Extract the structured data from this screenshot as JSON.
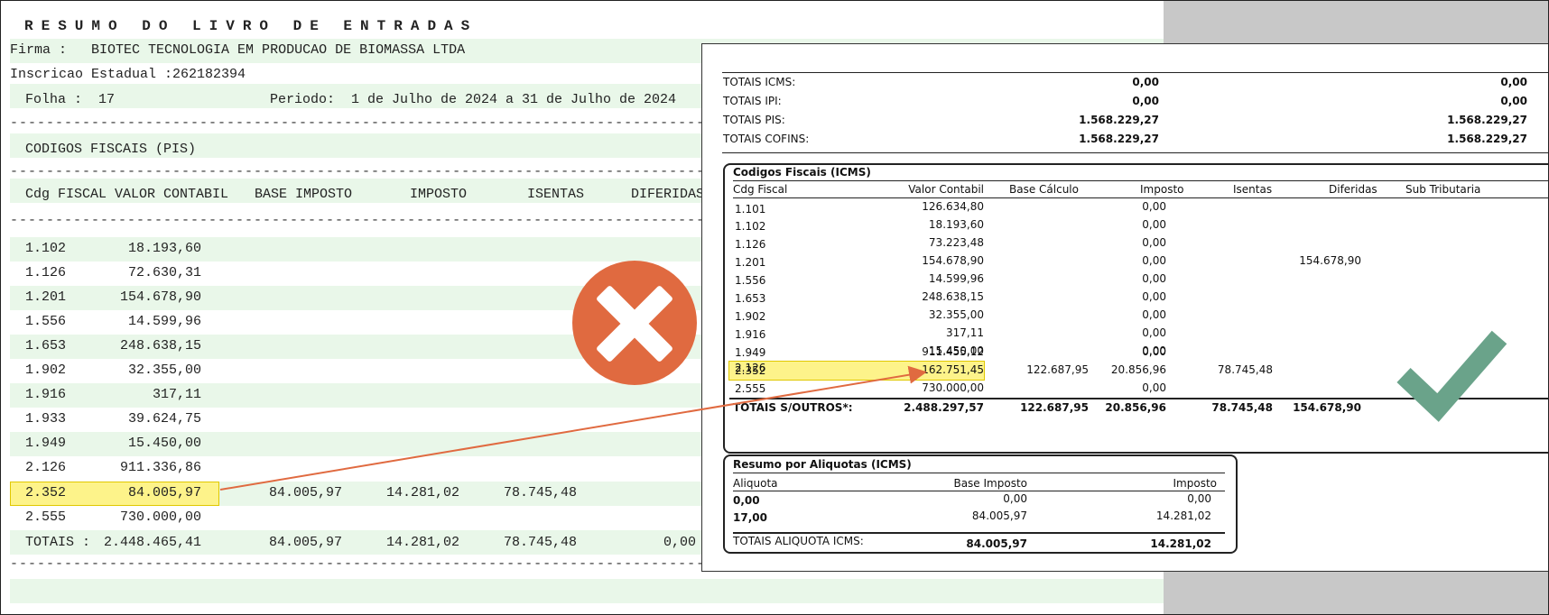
{
  "old_report": {
    "title": "RESUMO DO LIVRO DE ENTRADAS",
    "firma_label": "Firma :",
    "firma_value": "BIOTEC TECNOLOGIA EM PRODUCAO DE BIOMASSA LTDA",
    "inscricao_label": "Inscricao Estadual :",
    "inscricao_value": "262182394",
    "folha_label": "Folha :",
    "folha_value": "17",
    "periodo_label": "Periodo:",
    "periodo_value": "1 de Julho de 2024 a 31 de Julho de 2024",
    "dashes": "--------------------------------------------------------------------------------------------------------------------------------------------",
    "section_title": "CODIGOS FISCAIS (PIS)",
    "columns": [
      "Cdg FISCAL",
      "VALOR CONTABIL",
      "BASE IMPOSTO",
      "IMPOSTO",
      "ISENTAS",
      "DIFERIDAS"
    ],
    "rows": [
      {
        "cfop": "1.102",
        "valor": "18.193,60",
        "base": "",
        "imposto": "",
        "isentas": ""
      },
      {
        "cfop": "1.126",
        "valor": "72.630,31",
        "base": "",
        "imposto": "",
        "isentas": ""
      },
      {
        "cfop": "1.201",
        "valor": "154.678,90",
        "base": "",
        "imposto": "",
        "isentas": ""
      },
      {
        "cfop": "1.556",
        "valor": "14.599,96",
        "base": "",
        "imposto": "",
        "isentas": ""
      },
      {
        "cfop": "1.653",
        "valor": "248.638,15",
        "base": "",
        "imposto": "",
        "isentas": ""
      },
      {
        "cfop": "1.902",
        "valor": "32.355,00",
        "base": "",
        "imposto": "",
        "isentas": ""
      },
      {
        "cfop": "1.916",
        "valor": "317,11",
        "base": "",
        "imposto": "",
        "isentas": ""
      },
      {
        "cfop": "1.933",
        "valor": "39.624,75",
        "base": "",
        "imposto": "",
        "isentas": ""
      },
      {
        "cfop": "1.949",
        "valor": "15.450,00",
        "base": "",
        "imposto": "",
        "isentas": ""
      },
      {
        "cfop": "2.126",
        "valor": "911.336,86",
        "base": "",
        "imposto": "",
        "isentas": ""
      },
      {
        "cfop": "2.352",
        "valor": "84.005,97",
        "base": "84.005,97",
        "imposto": "14.281,02",
        "isentas": "78.745,48"
      },
      {
        "cfop": "2.555",
        "valor": "730.000,00",
        "base": "",
        "imposto": "",
        "isentas": ""
      }
    ],
    "totals": {
      "label": "TOTAIS :",
      "valor": "2.448.465,41",
      "base": "84.005,97",
      "imposto": "14.281,02",
      "isentas": "78.745,48",
      "diferidas": "0,00"
    }
  },
  "new_report": {
    "totals_top": [
      {
        "label": "TOTAIS ICMS:",
        "v1": "0,00",
        "v2": "0,00"
      },
      {
        "label": "TOTAIS IPI:",
        "v1": "0,00",
        "v2": "0,00"
      },
      {
        "label": "TOTAIS PIS:",
        "v1": "1.568.229,27",
        "v2": "1.568.229,27"
      },
      {
        "label": "TOTAIS COFINS:",
        "v1": "1.568.229,27",
        "v2": "1.568.229,27"
      }
    ],
    "codigos_title": "Codigos Fiscais (ICMS)",
    "codigos_columns": [
      "Cdg Fiscal",
      "Valor Contabil",
      "Base Cálculo",
      "Imposto",
      "Isentas",
      "Diferidas",
      "Sub Tributaria"
    ],
    "codigos_rows": [
      {
        "cfop": "1.101",
        "valor": "126.634,80",
        "base": "",
        "imposto": "0,00",
        "isentas": "",
        "diferidas": ""
      },
      {
        "cfop": "1.102",
        "valor": "18.193,60",
        "base": "",
        "imposto": "0,00",
        "isentas": "",
        "diferidas": ""
      },
      {
        "cfop": "1.126",
        "valor": "73.223,48",
        "base": "",
        "imposto": "0,00",
        "isentas": "",
        "diferidas": ""
      },
      {
        "cfop": "1.201",
        "valor": "154.678,90",
        "base": "",
        "imposto": "0,00",
        "isentas": "",
        "diferidas": "154.678,90"
      },
      {
        "cfop": "1.556",
        "valor": "14.599,96",
        "base": "",
        "imposto": "0,00",
        "isentas": "",
        "diferidas": ""
      },
      {
        "cfop": "1.653",
        "valor": "248.638,15",
        "base": "",
        "imposto": "0,00",
        "isentas": "",
        "diferidas": ""
      },
      {
        "cfop": "1.902",
        "valor": "32.355,00",
        "base": "",
        "imposto": "0,00",
        "isentas": "",
        "diferidas": ""
      },
      {
        "cfop": "1.916",
        "valor": "317,11",
        "base": "",
        "imposto": "0,00",
        "isentas": "",
        "diferidas": ""
      },
      {
        "cfop": "1.949",
        "valor": "15.450,00",
        "base": "",
        "imposto": "0,00",
        "isentas": "",
        "diferidas": ""
      },
      {
        "cfop": "2.126",
        "valor": "911.455,12",
        "base": "",
        "imposto": "0,00",
        "isentas": "",
        "diferidas": ""
      },
      {
        "cfop": "2.352",
        "valor": "162.751,45",
        "base": "122.687,95",
        "imposto": "20.856,96",
        "isentas": "78.745,48",
        "diferidas": ""
      },
      {
        "cfop": "2.555",
        "valor": "730.000,00",
        "base": "",
        "imposto": "0,00",
        "isentas": "",
        "diferidas": ""
      }
    ],
    "codigos_totals": {
      "label": "TOTAIS S/OUTROS*:",
      "valor": "2.488.297,57",
      "base": "122.687,95",
      "imposto": "20.856,96",
      "isentas": "78.745,48",
      "diferidas": "154.678,90"
    },
    "aliquotas_title": "Resumo por Aliquotas (ICMS)",
    "aliquotas_columns": [
      "Aliquota",
      "Base Imposto",
      "Imposto"
    ],
    "aliquotas_rows": [
      {
        "aliquota": "0,00",
        "base": "0,00",
        "imposto": "0,00"
      },
      {
        "aliquota": "17,00",
        "base": "84.005,97",
        "imposto": "14.281,02"
      }
    ],
    "aliquotas_totals": {
      "label": "TOTAIS ALIQUOTA ICMS:",
      "base": "84.005,97",
      "imposto": "14.281,02"
    }
  },
  "icons": {
    "wrong": "x-icon",
    "right": "check-icon",
    "arrow": "arrow-icon"
  },
  "colors": {
    "wrong": "#e06a40",
    "right": "#6aa38a",
    "highlight": "#fdf38a",
    "arrow": "#e06a40",
    "band": "#e9f7e9"
  }
}
